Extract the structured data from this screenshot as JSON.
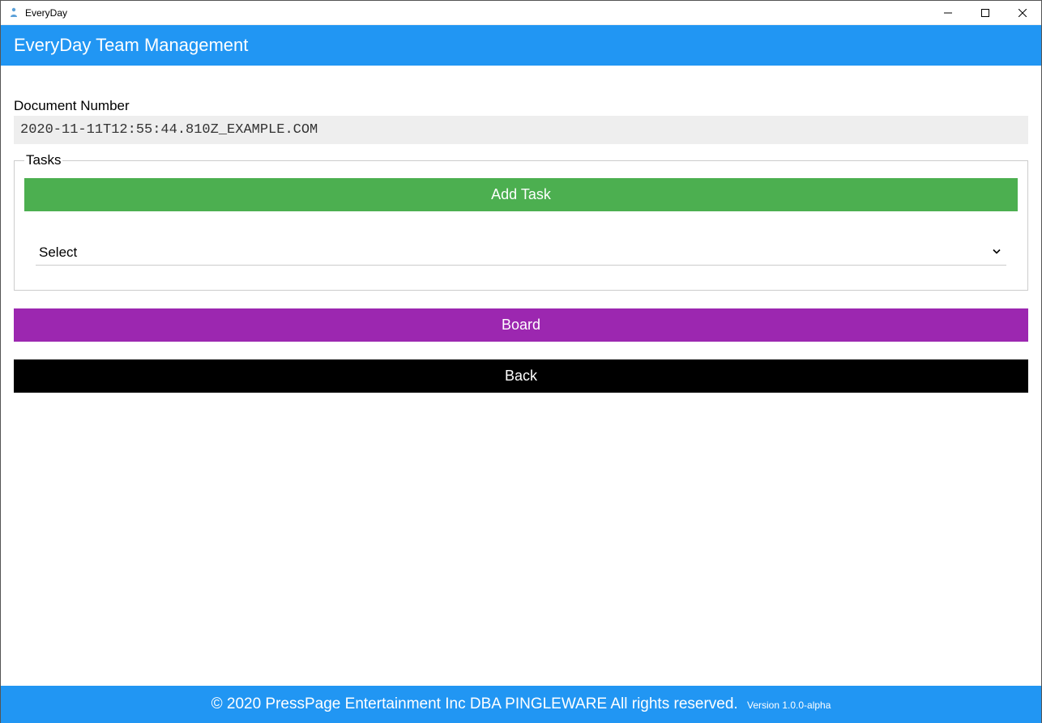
{
  "window": {
    "title": "EveryDay"
  },
  "header": {
    "title": "EveryDay Team Management"
  },
  "form": {
    "document_number_label": "Document Number",
    "document_number_value": "2020-11-11T12:55:44.810Z_EXAMPLE.COM",
    "tasks_legend": "Tasks",
    "add_task_label": "Add Task",
    "select_value": "Select",
    "board_label": "Board",
    "back_label": "Back"
  },
  "footer": {
    "copyright": "© 2020 PressPage Entertainment Inc DBA PINGLEWARE  All rights reserved.",
    "version": "Version 1.0.0-alpha"
  }
}
